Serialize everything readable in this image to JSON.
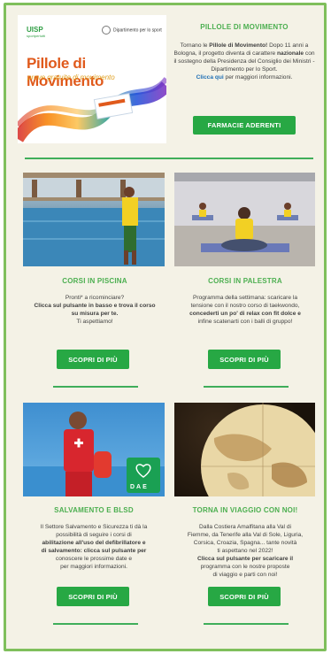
{
  "hero": {
    "image_alt": "Pillole di Movimento - prove gratuite di movimento",
    "logo_left": "UISP",
    "logo_left_sub": "sportpertutti",
    "logo_right": "Dipartimento per lo sport",
    "image_title": "Pillole di Movimento",
    "image_subtitle": "prove gratuite di movimento",
    "title": "PILLOLE DI MOVIMENTO",
    "text_1": "Tornano le ",
    "text_1b": "Pillole di Movimento!",
    "text_2": " Dopo 11 anni a Bologna, il progetto diventa di carattere ",
    "text_2b": "nazionale",
    "text_3": " con il sostegno della Presidenza del Consiglio dei Ministri - Dipartimento per lo Sport.",
    "link": "Clicca qui",
    "text_4": " per maggiori informazioni.",
    "button": "FARMACIE ADERENTI"
  },
  "cards": [
    {
      "image_alt": "Piscina",
      "title": "CORSI IN PISCINA",
      "lines": [
        "Pronti* a ricominciare?",
        "Clicca sul pulsante in basso e trova il corso",
        "su misura per te.",
        "Ti aspettiamo!"
      ],
      "button": "SCOPRI DI PIÙ"
    },
    {
      "image_alt": "Palestra",
      "title": "CORSI IN PALESTRA",
      "lines": [
        "Programma della settimana: scaricare la",
        "tensione con il nostro corso di taekwondo,",
        "concederti un po' di relax con fit dolce e",
        "infine scatenarti con i balli di gruppo!"
      ],
      "button": "SCOPRI DI PIÙ"
    },
    {
      "image_alt": "Salvamento",
      "image_label": "DAE",
      "title": "SALVAMENTO E BLSD",
      "lines": [
        "Il Settore Salvamento e Sicurezza ti dà la",
        "possibilità di seguire i corsi di",
        "abilitazione all'uso del defibrillatore e",
        "di salvamento: clicca sul pulsante per",
        "conoscere le prossime date e",
        "per maggiori informazioni."
      ],
      "button": "SCOPRI DI PIÙ"
    },
    {
      "image_alt": "Globo",
      "title": "TORNA IN VIAGGIO CON NOI!",
      "lines": [
        "Dalla Costiera Amalfitana alla Val di",
        "Fiemme, da Tenerife alla Val di Sole, Liguria,",
        "Corsica, Croazia, Spagna... tante novità",
        "ti aspettano nel 2022!",
        "Clicca sul pulsante per scaricare il",
        "programma con le nostre proposte",
        "di viaggio e parti con noi!"
      ],
      "button": "SCOPRI DI PIÙ"
    }
  ],
  "colors": {
    "accent": "#27a844",
    "title_green": "#4caf50",
    "frame_border": "#7fbf5c",
    "background": "#f4f2e6",
    "link": "#1e6fb5"
  }
}
